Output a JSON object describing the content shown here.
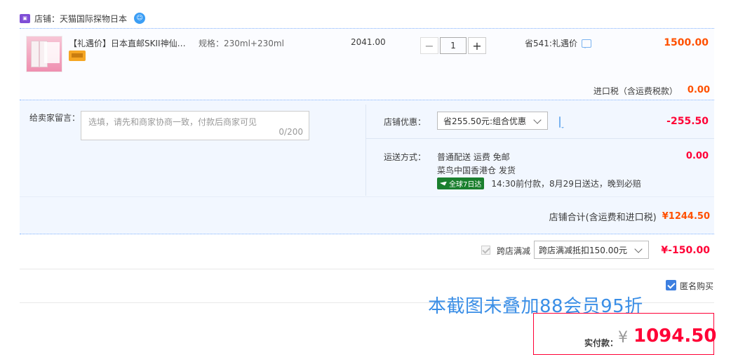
{
  "shop": {
    "label": "店铺：",
    "name": "天猫国际探物日本"
  },
  "item": {
    "title": "【礼遇价】日本直邮SKII神仙…",
    "spec": "规格：230ml+230ml",
    "price": "2041.00",
    "qty": "1",
    "minus": "−",
    "plus": "+",
    "save_note": "省541:礼遇价",
    "total": "1500.00",
    "tax_label": "进口税（含运费税款）",
    "tax_value": "0.00"
  },
  "message": {
    "label": "给卖家留言：",
    "placeholder": "选填，请先和商家协商一致，付款后商家可见",
    "count": "0/200"
  },
  "promo": {
    "label": "店铺优惠：",
    "selected": "省255.50元:组合优惠",
    "value": "-255.50"
  },
  "shipping": {
    "label": "运送方式：",
    "line1": "普通配送 运费 免邮",
    "line2": "菜鸟中国香港仓  发货",
    "badge": "全球7日达",
    "line3": "14:30前付款，8月29日送达，晚到必赔",
    "value": "0.00"
  },
  "shop_total": {
    "label": "店铺合计(含运费和进口税)",
    "value": "¥1244.50"
  },
  "cross_store": {
    "label": "跨店满减",
    "selected": "跨店满减抵扣150.00元",
    "value": "¥-150.00"
  },
  "anonymous": {
    "label": "匿名购买",
    "checked": true
  },
  "overlay_note": "本截图未叠加88会员95折",
  "payment": {
    "label": "实付款：",
    "currency": "¥",
    "value": "1094.50"
  },
  "colors": {
    "accent_orange": "#ff5000",
    "accent_red": "#ff0036",
    "brand_blue": "#3d7fe0"
  }
}
